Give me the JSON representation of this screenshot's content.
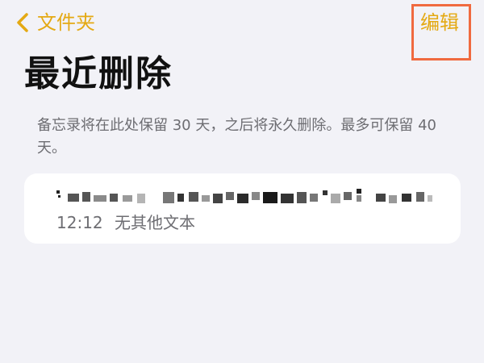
{
  "nav": {
    "back_label": "文件夹",
    "edit_label": "编辑"
  },
  "page": {
    "title": "最近删除",
    "info": "备忘录将在此处保留 30 天，之后将永久删除。最多可保留 40 天。"
  },
  "notes": [
    {
      "time": "12:12",
      "preview": "无其他文本"
    }
  ],
  "colors": {
    "accent": "#e4a913",
    "highlight_box": "#f06a3f",
    "background": "#f2f2f7",
    "card": "#ffffff",
    "secondary_text": "#6d6d72"
  },
  "icons": {
    "back": "chevron-left-icon"
  }
}
